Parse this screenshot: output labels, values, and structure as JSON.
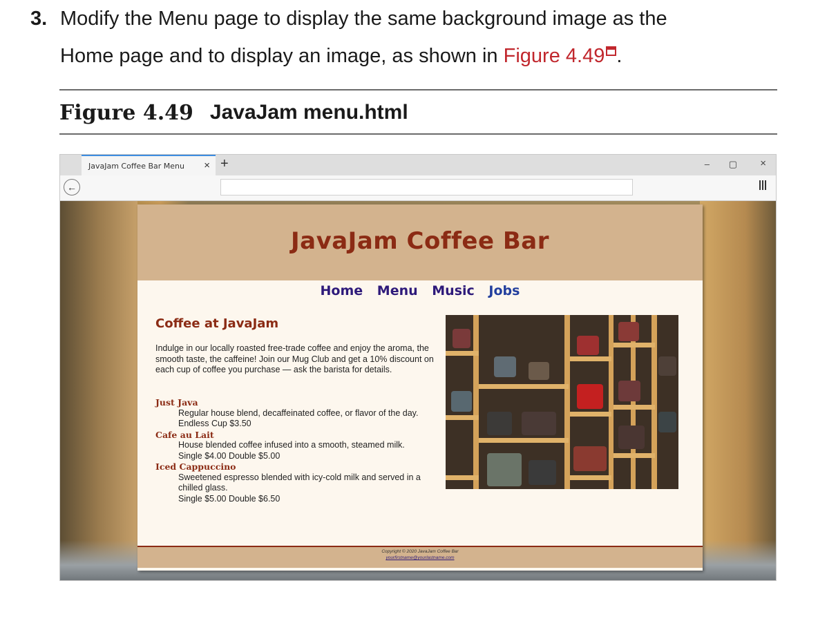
{
  "step": {
    "number": "3.",
    "line1": "Modify the Menu page to display the same background image as the",
    "line2_prefix": "Home page and to display an image, as shown in ",
    "link": "Figure 4.49",
    "line2_suffix": "."
  },
  "figure": {
    "label": "Figure 4.49",
    "title": "JavaJam menu.html"
  },
  "browser": {
    "tab_title": "JavaJam Coffee Bar Menu",
    "tab_close": "×",
    "new_tab": "+",
    "back": "←",
    "minimize": "–",
    "maximize": "▢",
    "close": "×"
  },
  "site": {
    "title": "JavaJam Coffee Bar",
    "nav": [
      "Home",
      "Menu",
      "Music",
      "Jobs"
    ],
    "heading": "Coffee at JavaJam",
    "intro": "Indulge in our locally roasted free-trade coffee and enjoy the aroma, the smooth taste, the caffeine! Join our Mug Club and get a 10% discount on each cup of coffee you purchase — ask the barista for details.",
    "menu": [
      {
        "name": "Just Java",
        "desc": "Regular house blend, decaffeinated coffee, or flavor of the day.",
        "price": "Endless Cup $3.50"
      },
      {
        "name": "Cafe au Lait",
        "desc": "House blended coffee infused into a smooth, steamed milk.",
        "price": "Single $4.00 Double $5.00"
      },
      {
        "name": "Iced Cappuccino",
        "desc": "Sweetened espresso blended with icy-cold milk and served in a chilled glass.",
        "price": "Single $5.00 Double $6.50"
      }
    ],
    "copyright": "Copyright © 2020 JavaJam Coffee Bar",
    "email": "yourfirstname@yourlastname.com"
  },
  "colors": {
    "link_red": "#c1272d",
    "site_brown": "#8b2b14",
    "header_tan": "#d3b38e",
    "nav_purple": "#2e1a7a"
  }
}
